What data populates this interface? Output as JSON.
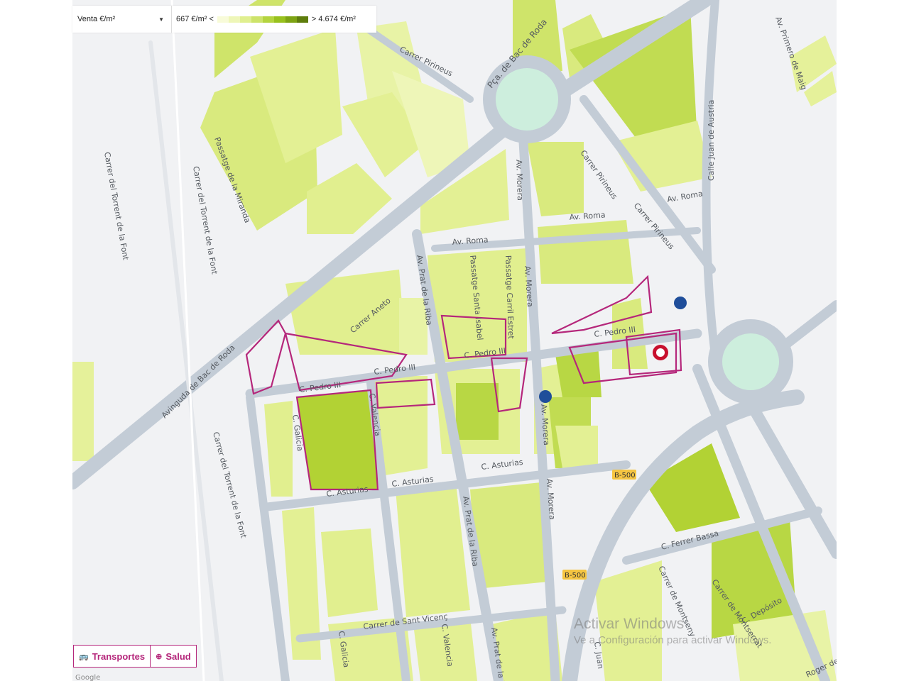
{
  "toolbar": {
    "metric_selected": "Venta €/m²",
    "legend_min": "667 €/m² <",
    "legend_max": "> 4.674 €/m²",
    "gradient_colors": [
      "#f8fbd9",
      "#eef6b8",
      "#e0ef8f",
      "#cde36a",
      "#b4d43f",
      "#98c11e",
      "#7da313",
      "#5e7d0c"
    ]
  },
  "buttons": {
    "transport_label": "Transportes",
    "transport_icon": "bus-icon",
    "health_label": "Salud",
    "health_icon": "plus-circle-icon"
  },
  "watermark": {
    "line1": "Activar Windows",
    "line2": "Ve a Configuración para activar Windows."
  },
  "map": {
    "colors": {
      "road": "#c3ccd6",
      "road_edge": "#b3bdc8",
      "plaza": "#cdeedd",
      "highlight": "#b5277b",
      "hospital": "#c8102e",
      "bus": "#1f4e9a",
      "shield": "#f5c542"
    },
    "street_labels": [
      "Avinguda de Bac de Roda",
      "Pça. de Bac de Roda",
      "Carrer Pirineus",
      "Carrer Pirineus",
      "Carrer Pirineus",
      "Av. Primero de Maig",
      "Calle Juan de Austria",
      "Av. Roma",
      "Av. Roma",
      "Av. Roma",
      "Av. Morera",
      "Av. Morera",
      "Av. Morera",
      "Av. Morera",
      "Av. Prat de la Riba",
      "Av. Prat de la Riba",
      "Av. Prat de la Riba",
      "C. Pedro III",
      "C. Pedro III",
      "C. Pedro III",
      "C. Pedro III",
      "C. Asturias",
      "C. Asturias",
      "C. Asturias",
      "C. Valencia",
      "C. Valencia",
      "C. Galicia",
      "C. Galicia",
      "C. Ferrer Bassa",
      "Carrer de Montseny",
      "Carrer de Montserrat",
      "C. Depósito",
      "Carrer de Sant Vicenç",
      "Carrer del Torrent de la Font",
      "Carrer del Torrent de la Font",
      "Carrer del Torrent de la Font",
      "Passatge de la Miranda",
      "Passatge Santa Isabel",
      "Passatge Carril Estret",
      "Carrer Aneto",
      "C. Juan",
      "Roger de F",
      "B-500",
      "B-500",
      "Google"
    ]
  }
}
